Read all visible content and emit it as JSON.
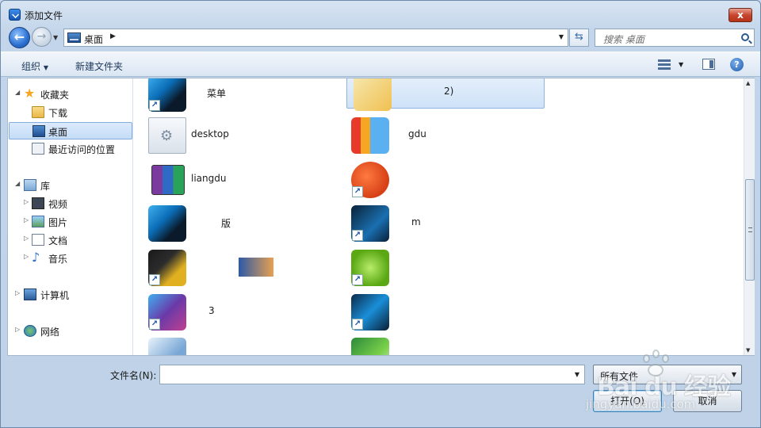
{
  "window": {
    "title": "添加文件",
    "close_label": "x"
  },
  "nav": {
    "back_glyph": "←",
    "forward_glyph": "→",
    "address": "桌面",
    "refresh_glyph": "⇆",
    "search_placeholder": "搜索 桌面"
  },
  "toolbar": {
    "organize": "组织",
    "new_folder": "新建文件夹",
    "help": "?"
  },
  "sidebar": {
    "favorites": "收藏夹",
    "downloads": "下载",
    "desktop": "桌面",
    "recent": "最近访问的位置",
    "libraries": "库",
    "videos": "视频",
    "pictures": "图片",
    "documents": "文档",
    "music": "音乐",
    "computer": "计算机",
    "network": "网络"
  },
  "files": [
    {
      "name": "菜单",
      "icon": "blurred-app-icon",
      "shortcut": true
    },
    {
      "name": "2)",
      "icon": "blurred-folder-icon",
      "shortcut": false,
      "selected": true
    },
    {
      "name": "desktop",
      "icon": "config-file-icon",
      "shortcut": false
    },
    {
      "name": "gdu",
      "icon": "blurred-app-icon",
      "shortcut": false
    },
    {
      "name": "liangdu",
      "icon": "rar-archive-icon",
      "shortcut": false
    },
    {
      "name": "",
      "icon": "blurred-app-icon",
      "shortcut": true
    },
    {
      "name": "版",
      "icon": "blurred-app-icon",
      "shortcut": false
    },
    {
      "name": "m",
      "icon": "blurred-app-icon",
      "shortcut": true
    },
    {
      "name": "",
      "icon": "blurred-app-icon",
      "shortcut": true
    },
    {
      "name": "",
      "icon": "blurred-app-icon",
      "shortcut": true
    },
    {
      "name": "3",
      "icon": "blurred-app-icon",
      "shortcut": true
    },
    {
      "name": "",
      "icon": "blurred-app-icon",
      "shortcut": true
    }
  ],
  "bottom": {
    "filename_label": "文件名(N):",
    "filename_value": "",
    "filetype": "所有文件",
    "open": "打开(O)",
    "cancel": "取消"
  },
  "watermark": {
    "text": "Bai du 经验",
    "url": "jingyan.baidu.com"
  }
}
